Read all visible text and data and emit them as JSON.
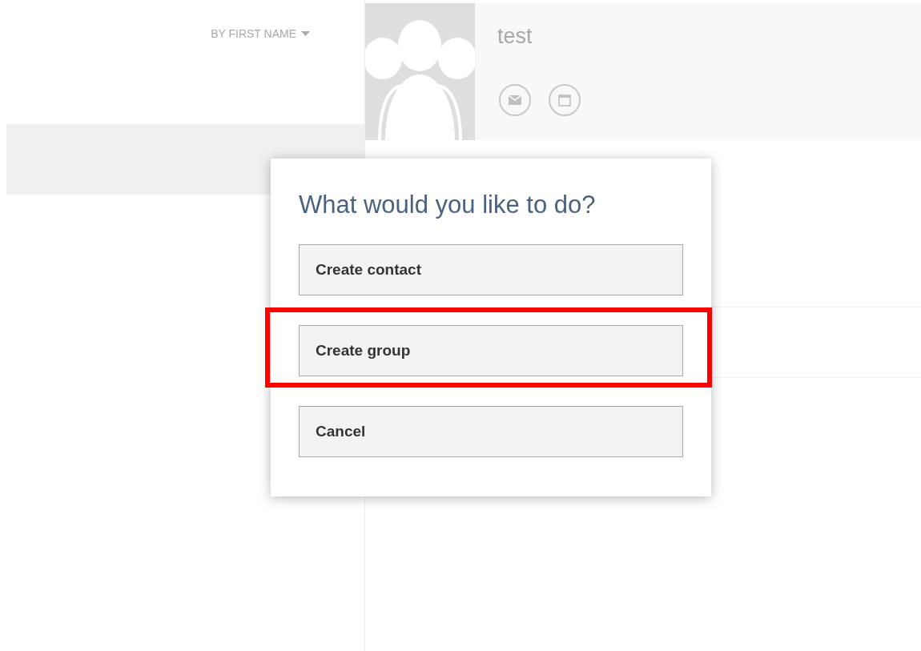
{
  "sort": {
    "label": "BY FIRST NAME"
  },
  "contact_list": {
    "rows": [
      {
        "selected": true
      }
    ]
  },
  "contact": {
    "name": "test"
  },
  "dialog": {
    "title": "What would you like to do?",
    "actions": [
      {
        "label": "Create contact",
        "highlighted": false
      },
      {
        "label": "Create group",
        "highlighted": true
      },
      {
        "label": "Cancel",
        "highlighted": false
      }
    ]
  }
}
